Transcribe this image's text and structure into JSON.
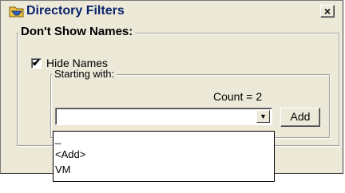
{
  "window": {
    "title": "Directory Filters",
    "close_label": "×"
  },
  "dont_show_group": {
    "legend": "Don't Show Names:",
    "hide_names": {
      "label": "Hide Names",
      "checked": true,
      "check_glyph": "✔"
    }
  },
  "starting_with_group": {
    "legend": "Starting with:",
    "count_text": "Count = 2",
    "combo_value": "",
    "combo_arrow": "▼",
    "add_label": "Add",
    "dropdown_items": [
      "_",
      "<Add>",
      "VM"
    ]
  },
  "icons": {
    "app": "directory-filter-icon",
    "close": "close-icon",
    "dropdown": "chevron-down-icon",
    "check": "check-icon"
  }
}
